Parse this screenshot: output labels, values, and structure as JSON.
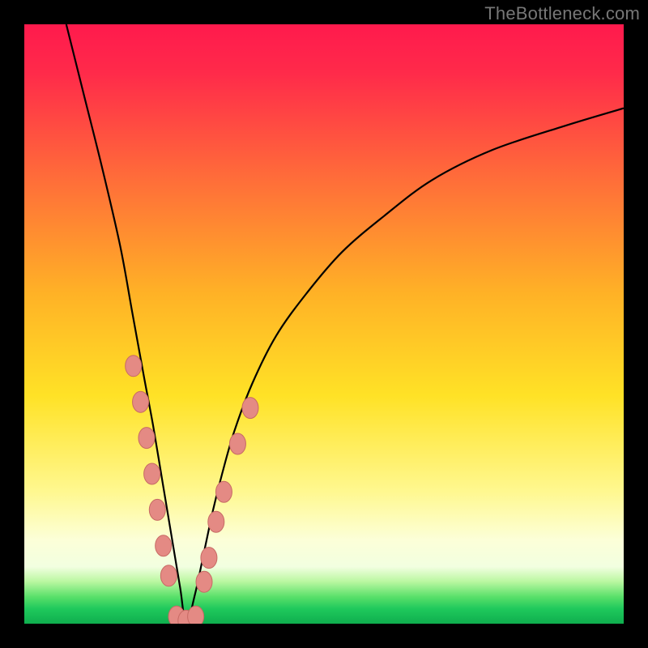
{
  "watermark": "TheBottleneck.com",
  "colors": {
    "frame": "#000000",
    "curve": "#000000",
    "markers_fill": "#e48a84",
    "markers_stroke": "#c76a64",
    "gradient_stops": [
      {
        "offset": 0.0,
        "color": "#ff1a4d"
      },
      {
        "offset": 0.08,
        "color": "#ff2a4a"
      },
      {
        "offset": 0.25,
        "color": "#ff6a3a"
      },
      {
        "offset": 0.45,
        "color": "#ffb226"
      },
      {
        "offset": 0.62,
        "color": "#ffe226"
      },
      {
        "offset": 0.78,
        "color": "#fff890"
      },
      {
        "offset": 0.86,
        "color": "#fcffd8"
      },
      {
        "offset": 0.905,
        "color": "#f2ffe0"
      },
      {
        "offset": 0.93,
        "color": "#b9f7a0"
      },
      {
        "offset": 0.955,
        "color": "#5ae06a"
      },
      {
        "offset": 0.975,
        "color": "#1fc95c"
      },
      {
        "offset": 1.0,
        "color": "#0fae4e"
      }
    ]
  },
  "chart_data": {
    "type": "line",
    "title": "",
    "xlabel": "",
    "ylabel": "",
    "xlim": [
      0,
      100
    ],
    "ylim": [
      0,
      100
    ],
    "grid": false,
    "curve_description": "V-shaped bottleneck curve: steep on the left side, shallower asymptotic rise on the right; minimum around x≈27 at y≈0.",
    "series": [
      {
        "name": "bottleneck-curve",
        "x": [
          7,
          10,
          13,
          16,
          18,
          20,
          21.5,
          23,
          24.5,
          26,
          27,
          28.5,
          30,
          31.5,
          33,
          35,
          38,
          42,
          47,
          53,
          60,
          68,
          78,
          90,
          100
        ],
        "y": [
          100,
          88,
          76,
          63,
          52,
          41,
          33,
          24,
          15,
          6,
          0,
          5,
          12,
          19,
          25,
          32,
          40,
          48,
          55,
          62,
          68,
          74,
          79,
          83,
          86
        ]
      }
    ],
    "markers": {
      "description": "Salmon-colored elliptical markers clustered along the lower portion of both arms of the V and across the bottom.",
      "points": [
        {
          "x": 18.2,
          "y": 43
        },
        {
          "x": 19.4,
          "y": 37
        },
        {
          "x": 20.4,
          "y": 31
        },
        {
          "x": 21.3,
          "y": 25
        },
        {
          "x": 22.2,
          "y": 19
        },
        {
          "x": 23.2,
          "y": 13
        },
        {
          "x": 24.1,
          "y": 8
        },
        {
          "x": 25.4,
          "y": 1.2
        },
        {
          "x": 27.0,
          "y": 0.5
        },
        {
          "x": 28.6,
          "y": 1.2
        },
        {
          "x": 30.0,
          "y": 7
        },
        {
          "x": 30.8,
          "y": 11
        },
        {
          "x": 32.0,
          "y": 17
        },
        {
          "x": 33.3,
          "y": 22
        },
        {
          "x": 35.6,
          "y": 30
        },
        {
          "x": 37.7,
          "y": 36
        }
      ]
    }
  }
}
